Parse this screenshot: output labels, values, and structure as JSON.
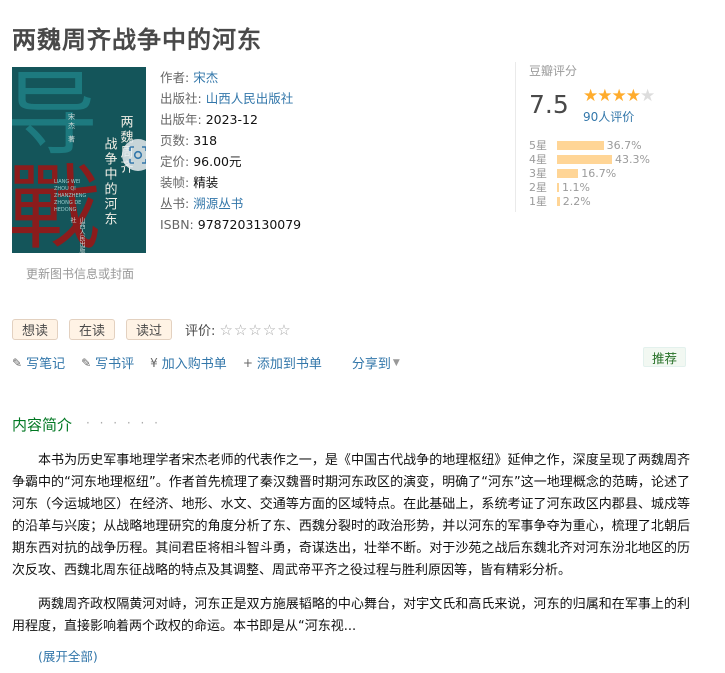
{
  "title": "两魏周齐战争中的河东",
  "cover": {
    "big_chars": [
      "导",
      "戰"
    ],
    "vertical_title_1": "两魏周齐",
    "vertical_title_2": "战争中的河东",
    "author_vertical": "宋杰 著",
    "english_text": "LIANG WEI ZHOU QI ZHANZHENG ZHONG DE HEDONG",
    "publisher_vertical": "山西人民出版社",
    "bg_color": "#14555a"
  },
  "update_link": "更新图书信息或封面",
  "info": [
    {
      "label": "作者:",
      "value": "宋杰",
      "link": true
    },
    {
      "label": "出版社:",
      "value": "山西人民出版社",
      "link": true
    },
    {
      "label": "出版年:",
      "value": "2023-12",
      "link": false
    },
    {
      "label": "页数:",
      "value": "318",
      "link": false
    },
    {
      "label": "定价:",
      "value": "96.00元",
      "link": false
    },
    {
      "label": "装帧:",
      "value": "精装",
      "link": false
    },
    {
      "label": "丛书:",
      "value": "溯源丛书",
      "link": true
    },
    {
      "label": "ISBN:",
      "value": "9787203130079",
      "link": false
    }
  ],
  "rating": {
    "label": "豆瓣评分",
    "score": "7.5",
    "stars_on": 4,
    "count": "90人评价",
    "bars": [
      {
        "label": "5星",
        "pct": "36.7%",
        "value": 36.7
      },
      {
        "label": "4星",
        "pct": "43.3%",
        "value": 43.3
      },
      {
        "label": "3星",
        "pct": "16.7%",
        "value": 16.7
      },
      {
        "label": "2星",
        "pct": "1.1%",
        "value": 1.1
      },
      {
        "label": "1星",
        "pct": "2.2%",
        "value": 2.2
      }
    ]
  },
  "actions": {
    "want": "想读",
    "reading": "在读",
    "read": "读过",
    "my_rating_label": "评价:",
    "my_stars": "☆☆☆☆☆"
  },
  "links": {
    "note": "写笔记",
    "review": "写书评",
    "cart": "加入购书单",
    "add_list": "添加到书单",
    "share": "分享到",
    "recommend": "推荐"
  },
  "icons": {
    "note": "✎",
    "review": "✎",
    "cart": "¥",
    "add": "+"
  },
  "intro": {
    "title": "内容简介",
    "dots": "· · · · · ·",
    "p1": "本书为历史军事地理学者宋杰老师的代表作之一，是《中国古代战争的地理枢纽》延伸之作，深度呈现了两魏周齐争霸中的“河东地理枢纽”。作者首先梳理了秦汉魏晋时期河东政区的演变，明确了“河东”这一地理概念的范畴，论述了河东（今运城地区）在经济、地形、水文、交通等方面的区域特点。在此基础上，系统考证了河东政区内郡县、城戍等的沿革与兴废；从战略地理研究的角度分析了东、西魏分裂时的政治形势，并以河东的军事争夺为重心，梳理了北朝后期东西对抗的战争历程。其间君臣将相斗智斗勇，奇谋迭出，壮举不断。对于沙苑之战后东魏北齐对河东汾北地区的历次反攻、西魏北周东征战略的特点及其调整、周武帝平齐之役过程与胜利原因等，皆有精彩分析。",
    "p2": "两魏周齐政权隔黄河对峙，河东正是双方施展韬略的中心舞台，对宇文氏和高氏来说，河东的归属和在军事上的利用程度，直接影响着两个政权的命运。本书即是从“河东视...",
    "expand": "(展开全部)"
  }
}
